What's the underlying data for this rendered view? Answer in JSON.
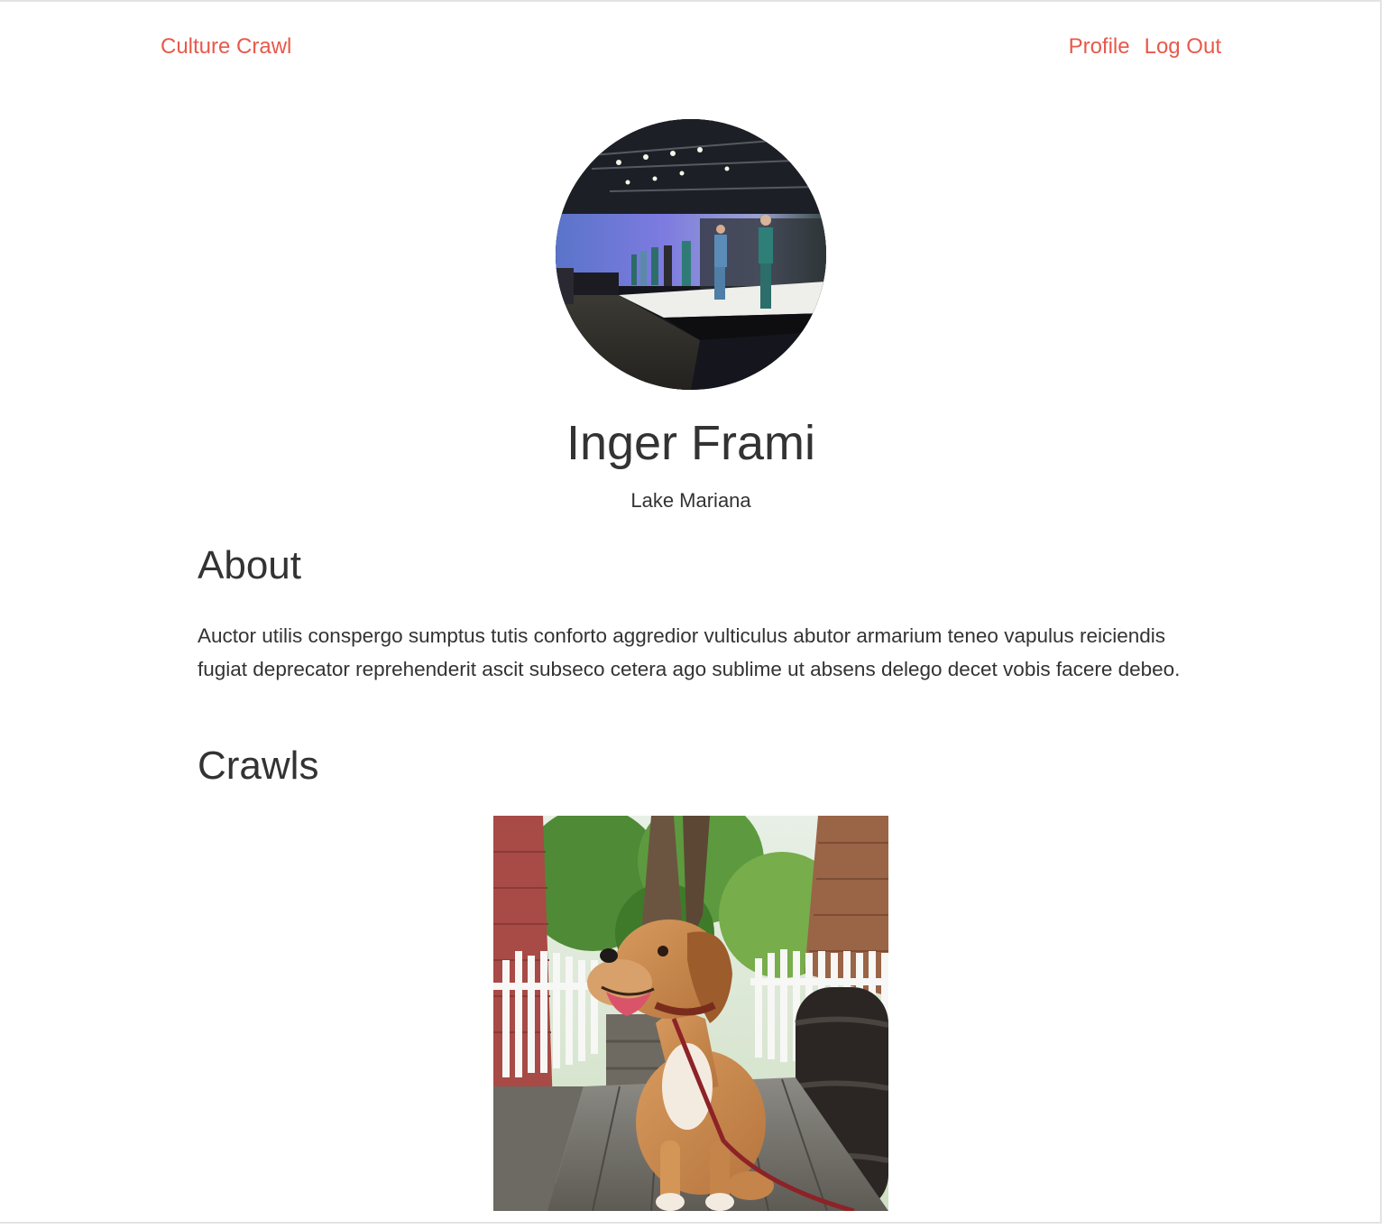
{
  "navbar": {
    "brand": "Culture Crawl",
    "links": [
      {
        "label": "Profile"
      },
      {
        "label": "Log Out"
      }
    ]
  },
  "profile": {
    "name": "Inger Frami",
    "location": "Lake Mariana",
    "avatar_icon": "fashion-runway-photo"
  },
  "about": {
    "heading": "About",
    "text": "Auctor utilis conspergo sumptus tutis conforto aggredior vulticulus abutor armarium teneo vapulus reiciendis fugiat deprecator reprehenderit ascit subseco cetera ago sublime ut absens delego decet vobis facere debeo."
  },
  "crawls": {
    "heading": "Crawls",
    "items": [
      {
        "image_icon": "dog-photo"
      }
    ]
  },
  "colors": {
    "accent": "#e8594b",
    "text": "#333333",
    "background": "#ffffff"
  }
}
